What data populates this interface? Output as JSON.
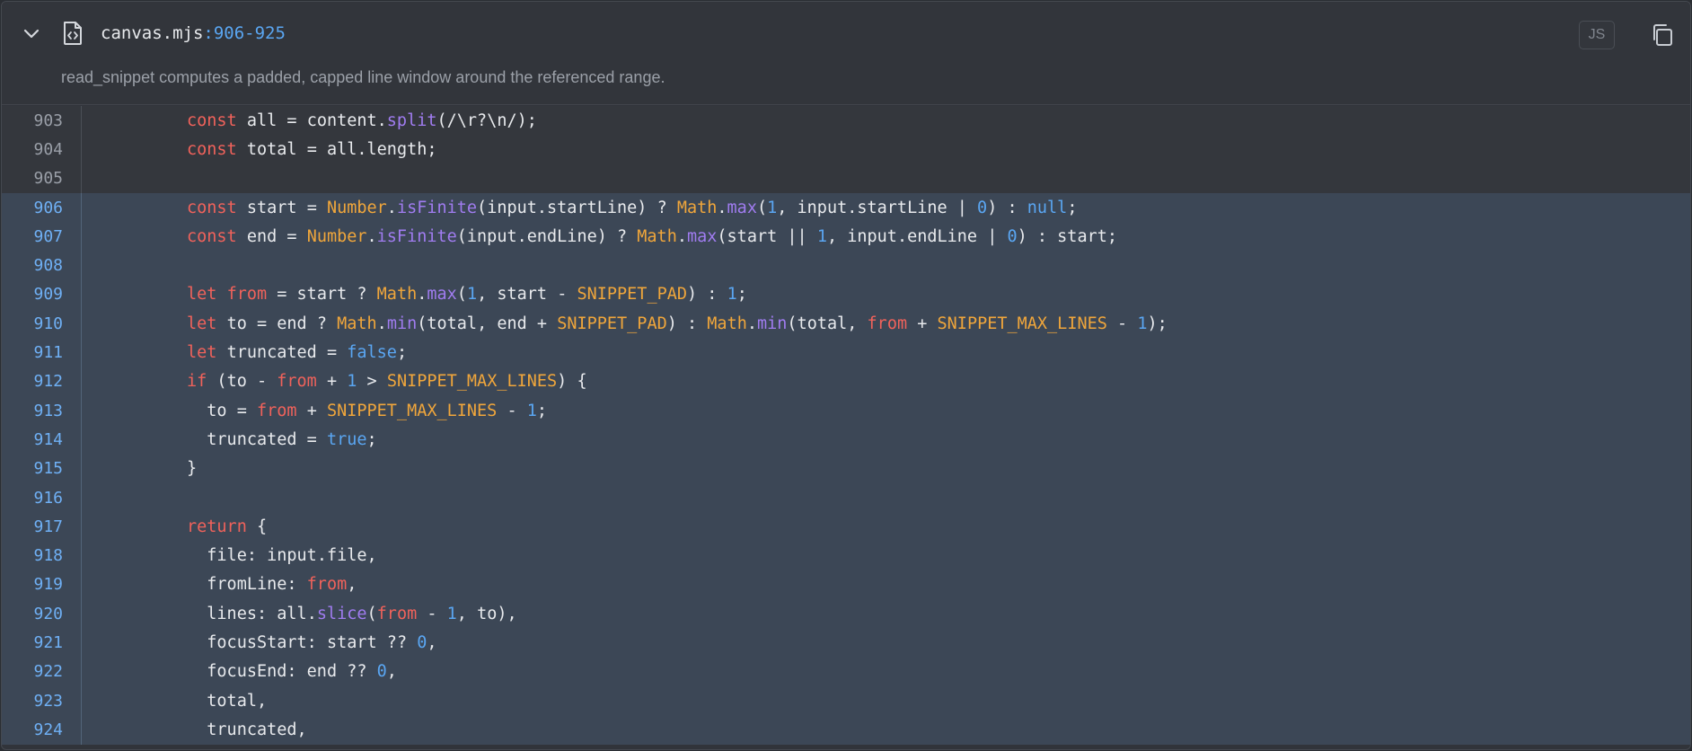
{
  "header": {
    "filename": "canvas.mjs",
    "range": ":906-925",
    "language_badge": "JS",
    "description": "read_snippet computes a padded, capped line window around the referenced range."
  },
  "icons": {
    "collapse": "chevron-down-icon",
    "file": "file-code-icon",
    "copy": "copy-icon"
  },
  "colors": {
    "keyword": "#f0625b",
    "literal": "#5aa6f2",
    "global": "#f0a63b",
    "method": "#a07cf0",
    "highlight_bg": "#3c4756",
    "line_number_highlight": "#6fb0f5"
  },
  "code": {
    "highlight_start": 906,
    "highlight_end": 925,
    "lines": [
      {
        "n": "903",
        "text": "const all = content.split(/\\r?\\n/);"
      },
      {
        "n": "904",
        "text": "const total = all.length;"
      },
      {
        "n": "905",
        "text": ""
      },
      {
        "n": "906",
        "text": "const start = Number.isFinite(input.startLine) ? Math.max(1, input.startLine | 0) : null;"
      },
      {
        "n": "907",
        "text": "const end = Number.isFinite(input.endLine) ? Math.max(start || 1, input.endLine | 0) : start;"
      },
      {
        "n": "908",
        "text": ""
      },
      {
        "n": "909",
        "text": "let from = start ? Math.max(1, start - SNIPPET_PAD) : 1;"
      },
      {
        "n": "910",
        "text": "let to = end ? Math.min(total, end + SNIPPET_PAD) : Math.min(total, from + SNIPPET_MAX_LINES - 1);"
      },
      {
        "n": "911",
        "text": "let truncated = false;"
      },
      {
        "n": "912",
        "text": "if (to - from + 1 > SNIPPET_MAX_LINES) {"
      },
      {
        "n": "913",
        "text": "  to = from + SNIPPET_MAX_LINES - 1;"
      },
      {
        "n": "914",
        "text": "  truncated = true;"
      },
      {
        "n": "915",
        "text": "}"
      },
      {
        "n": "916",
        "text": ""
      },
      {
        "n": "917",
        "text": "return {"
      },
      {
        "n": "918",
        "text": "  file: input.file,"
      },
      {
        "n": "919",
        "text": "  fromLine: from,"
      },
      {
        "n": "920",
        "text": "  lines: all.slice(from - 1, to),"
      },
      {
        "n": "921",
        "text": "  focusStart: start ?? 0,"
      },
      {
        "n": "922",
        "text": "  focusEnd: end ?? 0,"
      },
      {
        "n": "923",
        "text": "  total,"
      },
      {
        "n": "924",
        "text": "  truncated,"
      }
    ]
  }
}
